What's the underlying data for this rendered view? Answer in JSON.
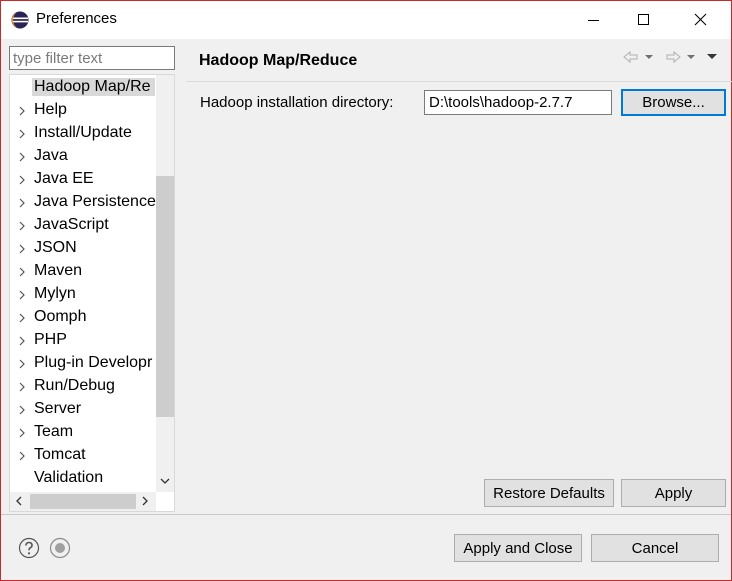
{
  "window": {
    "title": "Preferences"
  },
  "filter": {
    "placeholder": "type filter text"
  },
  "tree": {
    "items": [
      {
        "label": "Hadoop Map/Re",
        "expandable": false,
        "selected": true
      },
      {
        "label": "Help",
        "expandable": true
      },
      {
        "label": "Install/Update",
        "expandable": true
      },
      {
        "label": "Java",
        "expandable": true
      },
      {
        "label": "Java EE",
        "expandable": true
      },
      {
        "label": "Java Persistence",
        "expandable": true
      },
      {
        "label": "JavaScript",
        "expandable": true
      },
      {
        "label": "JSON",
        "expandable": true
      },
      {
        "label": "Maven",
        "expandable": true
      },
      {
        "label": "Mylyn",
        "expandable": true
      },
      {
        "label": "Oomph",
        "expandable": true
      },
      {
        "label": "PHP",
        "expandable": true
      },
      {
        "label": "Plug-in Developr",
        "expandable": true
      },
      {
        "label": "Run/Debug",
        "expandable": true
      },
      {
        "label": "Server",
        "expandable": true
      },
      {
        "label": "Team",
        "expandable": true
      },
      {
        "label": "Tomcat",
        "expandable": true
      },
      {
        "label": "Validation",
        "expandable": false
      }
    ]
  },
  "page": {
    "title": "Hadoop Map/Reduce",
    "dir_label": "Hadoop installation directory:",
    "dir_value": "D:\\tools\\hadoop-2.7.7",
    "browse_label": "Browse...",
    "restore_label": "Restore Defaults",
    "apply_label": "Apply"
  },
  "footer": {
    "apply_close_label": "Apply and Close",
    "cancel_label": "Cancel"
  },
  "colors": {
    "accent": "#0078d7",
    "window_border": "#c42b2b",
    "selection": "#d9d9d9"
  }
}
